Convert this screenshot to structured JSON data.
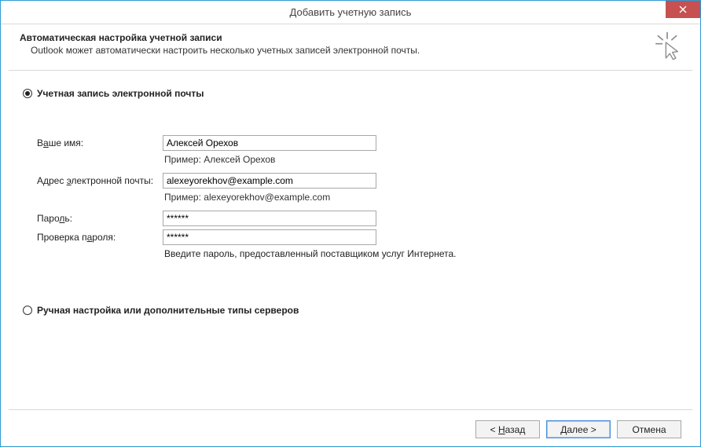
{
  "window": {
    "title": "Добавить учетную запись"
  },
  "header": {
    "title": "Автоматическая настройка учетной записи",
    "subtitle": "Outlook может автоматически настроить несколько учетных записей электронной почты."
  },
  "radios": {
    "email_account": "Учетная запись электронной почты",
    "manual": "Ручная настройка или дополнительные типы серверов"
  },
  "fields": {
    "name": {
      "label_pre": "В",
      "label_u": "а",
      "label_post": "ше имя:",
      "value": "Алексей Орехов",
      "example": "Пример: Алексей Орехов"
    },
    "email": {
      "label_pre": "Адрес ",
      "label_u": "э",
      "label_post": "лектронной почты:",
      "value": "alexeyorekhov@example.com",
      "example": "Пример: alexeyorekhov@example.com"
    },
    "password": {
      "label_pre": "Паро",
      "label_u": "л",
      "label_post": "ь:",
      "value": "******"
    },
    "confirm": {
      "label_pre": "Проверка п",
      "label_u": "а",
      "label_post": "роля:",
      "value": "******"
    },
    "password_hint": "Введите пароль, предоставленный поставщиком услуг Интернета."
  },
  "footer": {
    "back_pre": "< ",
    "back_u": "Н",
    "back_post": "азад",
    "next_pre": "",
    "next_u": "Д",
    "next_post": "алее >",
    "cancel": "Отмена"
  }
}
